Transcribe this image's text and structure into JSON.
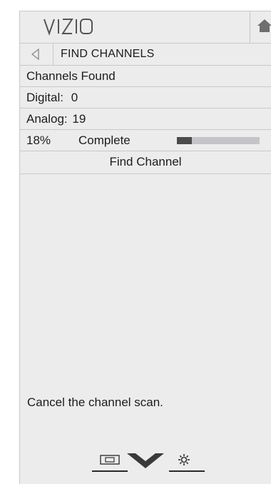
{
  "header": {
    "brand": "VIZIO",
    "home_icon": "home-icon"
  },
  "menu": {
    "back_icon": "back-arrow-icon",
    "title": "FIND CHANNELS",
    "channels_found_label": "Channels Found",
    "digital_label": "Digital:",
    "digital_value": "0",
    "analog_label": "Analog:",
    "analog_value": "19",
    "progress_percent": "18%",
    "progress_label": "Complete",
    "progress_fraction": 0.18,
    "find_channel_label": "Find Channel"
  },
  "description": "Cancel the channel scan.",
  "footer": {
    "icons": [
      "pip-icon",
      "down-chevron-icon",
      "gear-icon"
    ]
  },
  "colors": {
    "panel_bg": "#ececec",
    "progress_fill": "#4a4a4a",
    "progress_track": "#c5c5c9"
  }
}
